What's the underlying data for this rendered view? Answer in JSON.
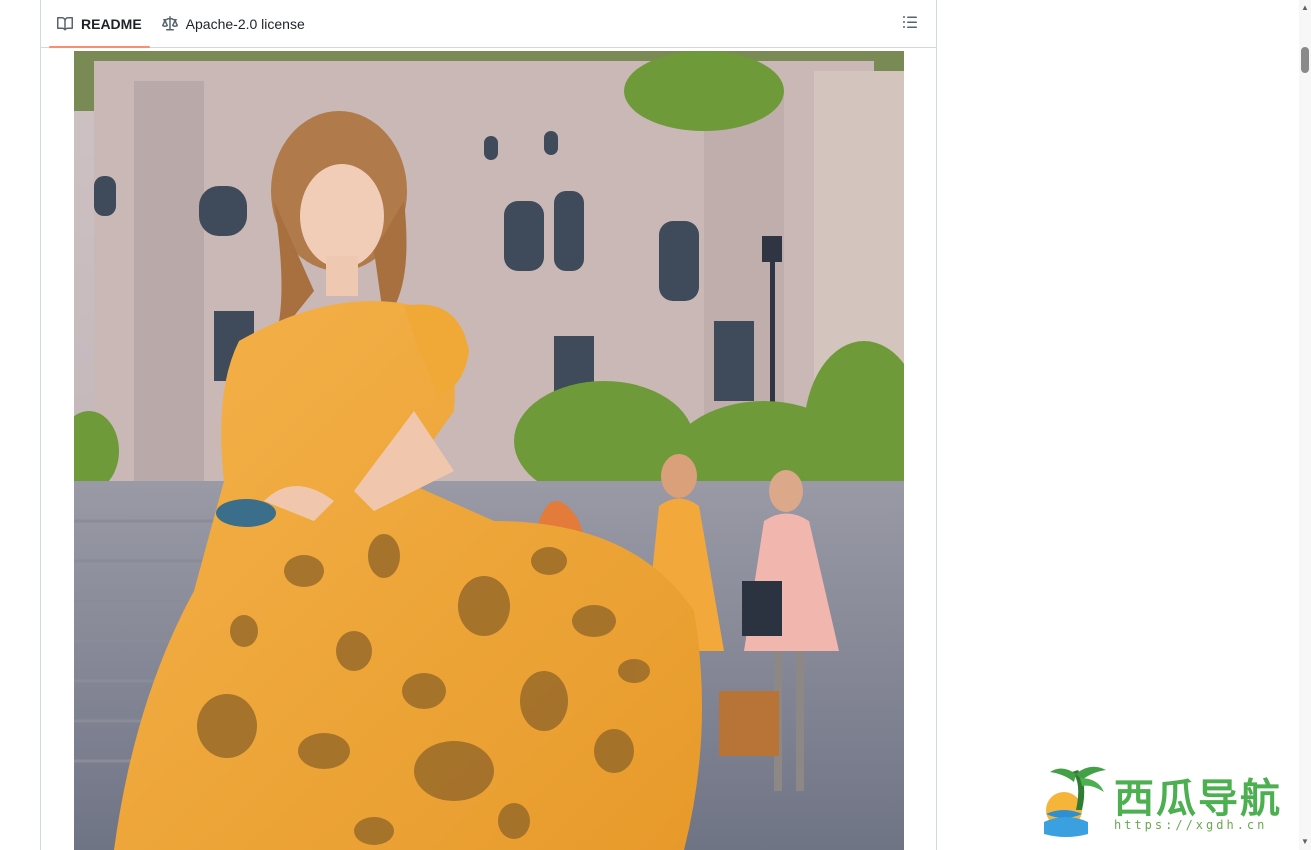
{
  "readme_tabs": [
    {
      "label": "README",
      "icon": "book-icon",
      "active": true
    },
    {
      "label": "Apache-2.0 license",
      "icon": "law-icon",
      "active": false
    }
  ],
  "outline_icon": "list-unordered-icon",
  "image": {
    "subject": "woman-in-yellow-spotted-dress-castle-courtyard"
  },
  "watermark": {
    "title": "西瓜导航",
    "url": "https://xgdh.cn"
  },
  "colors": {
    "accent_underline": "#fd8c73",
    "border": "#d1d9e0",
    "watermark_green": "#4caf50"
  }
}
